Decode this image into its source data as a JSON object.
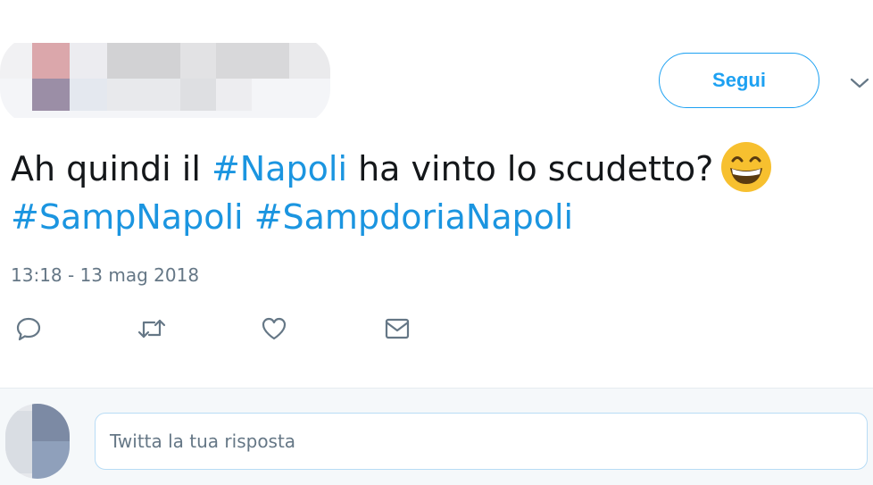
{
  "header": {
    "follow_label": "Segui",
    "chevron_icon": "chevron-down-icon"
  },
  "tweet": {
    "text_before": "Ah quindi il ",
    "hashtag_1": "#Napoli",
    "text_middle": " ha vinto lo scudetto?",
    "emoji_icon": "grinning-face-emoji",
    "hashtag_2": "#SampNapoli",
    "hashtag_3": "#SampdoriaNapoli",
    "timestamp": "13:18 - 13 mag 2018"
  },
  "actions": {
    "reply_icon": "reply-icon",
    "retweet_icon": "retweet-icon",
    "like_icon": "heart-icon",
    "dm_icon": "envelope-icon"
  },
  "reply": {
    "placeholder": "Twitta la tua risposta"
  },
  "colors": {
    "accent": "#1da1f2",
    "hashtag": "#1b95e0",
    "text": "#14171a",
    "muted": "#657786",
    "emoji": "#f7c02f"
  }
}
